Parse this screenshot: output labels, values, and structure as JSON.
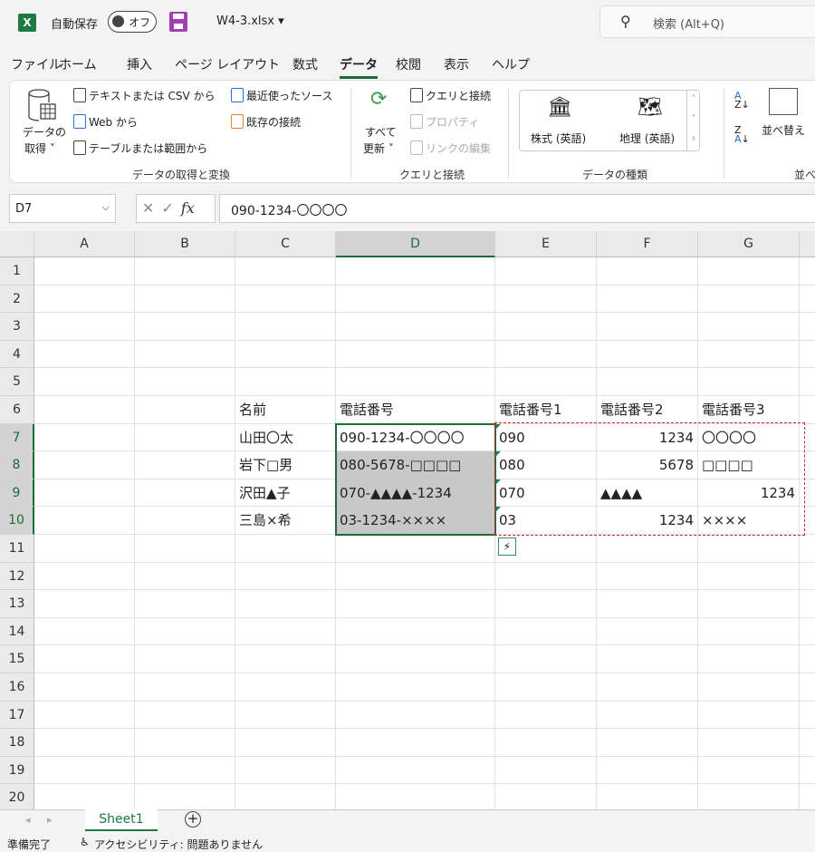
{
  "titlebar": {
    "app_icon": "X",
    "autosave_label": "自動保存",
    "autosave_state": "オフ",
    "filename": "W4-3.xlsx ▾",
    "search_placeholder": "検索 (Alt+Q)"
  },
  "tabs": [
    "ファイル",
    "ホーム",
    "挿入",
    "ページ レイアウト",
    "数式",
    "データ",
    "校閲",
    "表示",
    "ヘルプ"
  ],
  "active_tab": "データ",
  "ribbon": {
    "get_data": "データの",
    "get_data2": "取得 ˅",
    "from_text": "テキストまたは CSV から",
    "from_web": "Web から",
    "from_table": "テーブルまたは範囲から",
    "recent_sources": "最近使ったソース",
    "existing_conn": "既存の接続",
    "group1": "データの取得と変換",
    "refresh_all": "すべて",
    "refresh_all2": "更新 ˅",
    "queries": "クエリと接続",
    "properties": "プロパティ",
    "edit_links": "リンクの編集",
    "group2": "クエリと接続",
    "stocks": "株式 (英語)",
    "geography": "地理 (英語)",
    "group3": "データの種類",
    "sort": "並べ替え",
    "group4": "並べ"
  },
  "formula_bar": {
    "name_box": "D7",
    "fx": "fx",
    "value": "090-1234-〇〇〇〇"
  },
  "columns": [
    "A",
    "B",
    "C",
    "D",
    "E",
    "F",
    "G"
  ],
  "rows": [
    "1",
    "2",
    "3",
    "4",
    "5",
    "6",
    "7",
    "8",
    "9",
    "10",
    "11",
    "12",
    "13",
    "14",
    "15",
    "16",
    "17",
    "18",
    "19",
    "20"
  ],
  "cells": [
    {
      "row": 6,
      "col": "C",
      "v": "名前"
    },
    {
      "row": 6,
      "col": "D",
      "v": "電話番号"
    },
    {
      "row": 6,
      "col": "E",
      "v": "電話番号1"
    },
    {
      "row": 6,
      "col": "F",
      "v": "電話番号2"
    },
    {
      "row": 6,
      "col": "G",
      "v": "電話番号3"
    },
    {
      "row": 7,
      "col": "C",
      "v": "山田〇太"
    },
    {
      "row": 7,
      "col": "D",
      "v": "090-1234-〇〇〇〇"
    },
    {
      "row": 7,
      "col": "E",
      "v": "090"
    },
    {
      "row": 7,
      "col": "F",
      "v": "1234",
      "align": "right"
    },
    {
      "row": 7,
      "col": "G",
      "v": "〇〇〇〇"
    },
    {
      "row": 8,
      "col": "C",
      "v": "岩下□男"
    },
    {
      "row": 8,
      "col": "D",
      "v": "080-5678-□□□□"
    },
    {
      "row": 8,
      "col": "E",
      "v": "080"
    },
    {
      "row": 8,
      "col": "F",
      "v": "5678",
      "align": "right"
    },
    {
      "row": 8,
      "col": "G",
      "v": "□□□□"
    },
    {
      "row": 9,
      "col": "C",
      "v": "沢田▲子"
    },
    {
      "row": 9,
      "col": "D",
      "v": "070-▲▲▲▲-1234"
    },
    {
      "row": 9,
      "col": "E",
      "v": "070"
    },
    {
      "row": 9,
      "col": "F",
      "v": "▲▲▲▲"
    },
    {
      "row": 9,
      "col": "G",
      "v": "1234",
      "align": "right"
    },
    {
      "row": 10,
      "col": "C",
      "v": "三島×希"
    },
    {
      "row": 10,
      "col": "D",
      "v": "03-1234-××××"
    },
    {
      "row": 10,
      "col": "E",
      "v": "03"
    },
    {
      "row": 10,
      "col": "F",
      "v": "1234",
      "align": "right"
    },
    {
      "row": 10,
      "col": "G",
      "v": "××××"
    }
  ],
  "selection": {
    "active": "D7",
    "range": "D7:D10"
  },
  "sheet_tabs": [
    "Sheet1"
  ],
  "status": {
    "ready": "準備完了",
    "accessibility": "アクセシビリティ: 問題ありません"
  },
  "colors": {
    "accent": "#1d6b3a",
    "selection_fill": "#c8c8c8",
    "flash_fill_border": "#e0202a"
  }
}
